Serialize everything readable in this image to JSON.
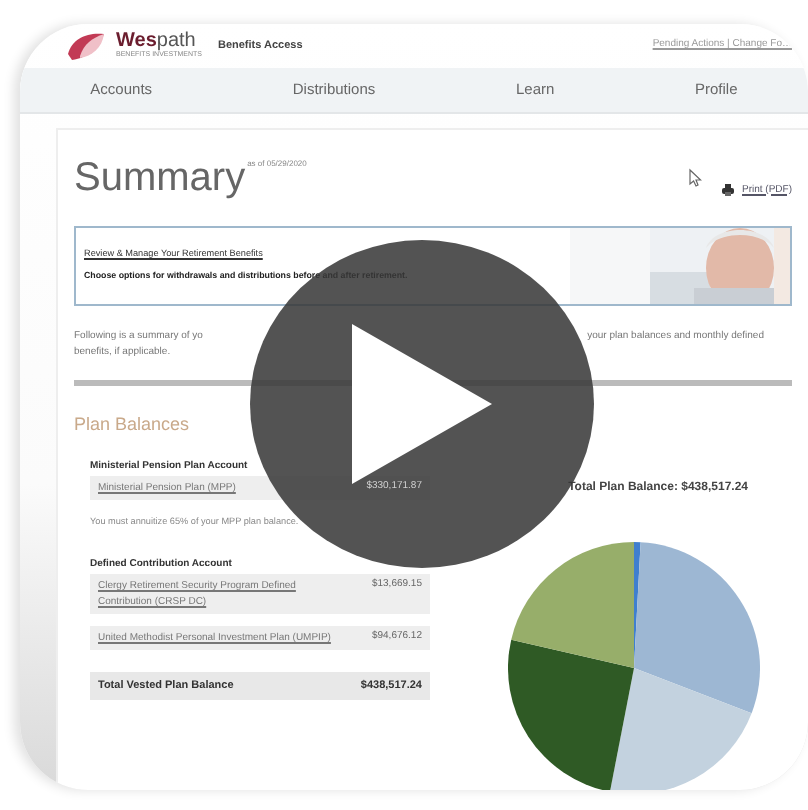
{
  "header": {
    "logo": "**Wes**path",
    "logo_tagline": "BENEFITS INVESTMENTS",
    "app_name": "Benefits Access",
    "user_links": "Pending Actions | Change Fo…"
  },
  "nav": [
    {
      "label": "Accounts",
      "selected": false
    },
    {
      "label": "Distributions",
      "selected": false
    },
    {
      "label": "Learn",
      "selected": false
    },
    {
      "label": "Profile",
      "selected": false
    }
  ],
  "summary": {
    "title": "Summary",
    "as_of": "as of 05/29/2020",
    "print_link": "Print (PDF)"
  },
  "banner": {
    "link": "Review & Manage Your Retirement Benefits",
    "subtitle": "Choose options for withdrawals and distributions before and after retirement."
  },
  "intro": {
    "line_1_start": "Following is a summary of yo",
    "line_1_end": "your plan balances and monthly defined",
    "line_2": "benefits, if applicable."
  },
  "plan_balances": {
    "title": "Plan Balances",
    "total_plan_balance": "Total Plan Balance: $438,517.24",
    "groups": [
      {
        "title": "Ministerial Pension Plan Account",
        "rows": [
          {
            "name": "Ministerial Pension Plan (MPP)",
            "amount": "$330,171.87"
          }
        ],
        "note": "You must annuitize 65% of your MPP plan balance."
      },
      {
        "title": "Defined Contribution Account",
        "rows": [
          {
            "name": "Clergy Retirement Security Program Defined Contribution (CRSP DC)",
            "amount": "$13,669.15"
          },
          {
            "name": "United Methodist Personal Investment Plan (UMPIP)",
            "amount": "$94,676.12"
          }
        ]
      }
    ],
    "total_vested": {
      "label": "Total Vested Plan Balance",
      "amount": "$438,517.24"
    }
  }
}
